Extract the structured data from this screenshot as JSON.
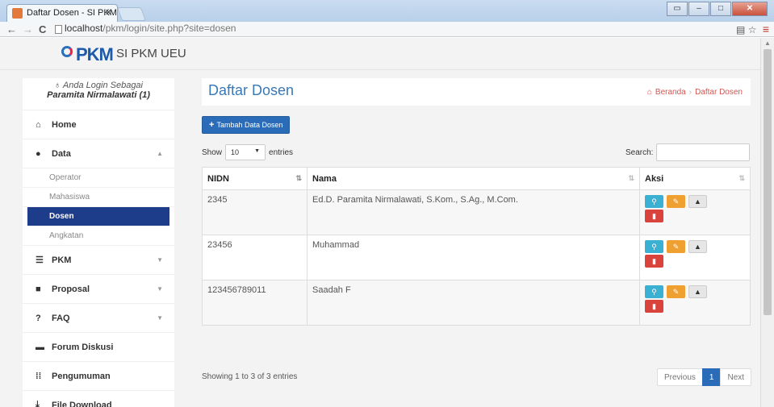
{
  "browser": {
    "tab_title": "Daftar Dosen - SI PKM UE",
    "url_host": "localhost",
    "url_rest": "/pkm/login/site.php?site=dosen"
  },
  "header": {
    "logo_text": "PKM",
    "brand": "SI PKM UEU"
  },
  "sidebar": {
    "login_greeting": "Anda Login Sebagai",
    "login_user": "Paramita Nirmalawati (1)",
    "items": [
      {
        "label": "Home",
        "icon": "home-icon"
      },
      {
        "label": "Data",
        "icon": "user-icon"
      },
      {
        "label": "PKM",
        "icon": "list-icon"
      },
      {
        "label": "Proposal",
        "icon": "book-icon"
      },
      {
        "label": "FAQ",
        "icon": "question-icon"
      },
      {
        "label": "Forum Diskusi",
        "icon": "comment-icon"
      },
      {
        "label": "Pengumuman",
        "icon": "grid-icon"
      },
      {
        "label": "File Download",
        "icon": "download-icon"
      }
    ],
    "data_submenu": [
      "Operator",
      "Mahasiswa",
      "Dosen",
      "Angkatan"
    ]
  },
  "content": {
    "title": "Daftar Dosen",
    "breadcrumb_home": "Beranda",
    "breadcrumb_current": "Daftar Dosen",
    "add_button": "Tambah Data Dosen",
    "show_label": "Show",
    "entries_value": "10",
    "entries_label": "entries",
    "search_label": "Search:",
    "columns": [
      "NIDN",
      "Nama",
      "Aksi"
    ],
    "rows": [
      {
        "nidn": "2345",
        "nama": "Ed.D. Paramita Nirmalawati, S.Kom., S.Ag., M.Com."
      },
      {
        "nidn": "23456",
        "nama": "Muhammad"
      },
      {
        "nidn": "123456789011",
        "nama": "Saadah F"
      }
    ],
    "info": "Showing 1 to 3 of 3 entries",
    "pager": {
      "previous": "Previous",
      "page": "1",
      "next": "Next"
    }
  },
  "colors": {
    "primary": "#2a6cb8",
    "active_menu": "#1d3d8a",
    "title": "#3a78b6",
    "danger": "#d9433b",
    "warning": "#f0a030",
    "info": "#3ab0d2"
  }
}
